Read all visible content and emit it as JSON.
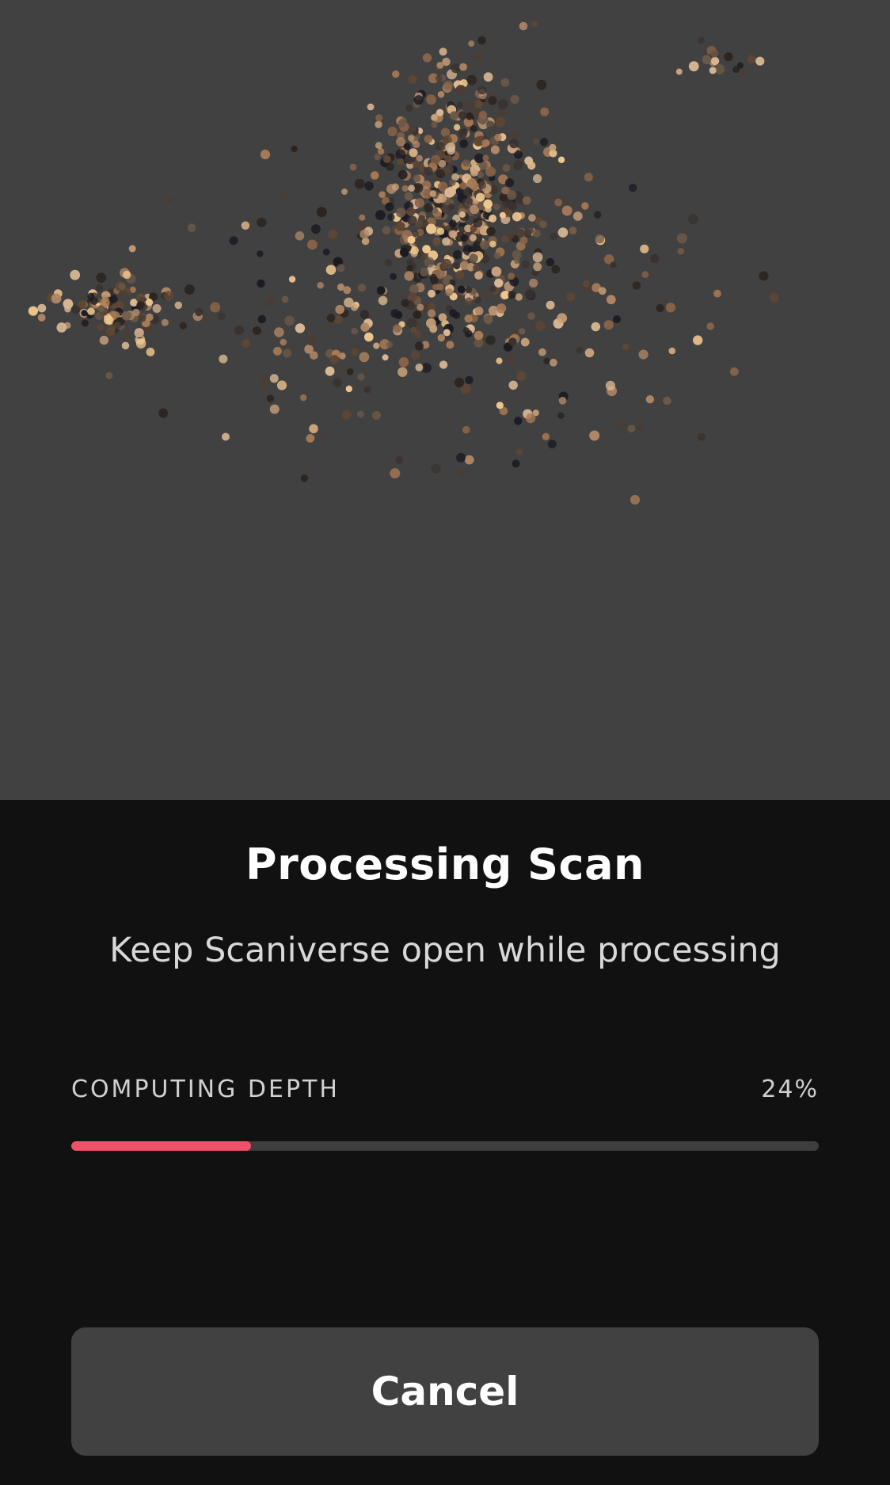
{
  "screen": {
    "title": "Processing Scan",
    "subtitle": "Keep Scaniverse open while processing"
  },
  "progress": {
    "label": "COMPUTING DEPTH",
    "percent_text": "24%",
    "value": 0.24
  },
  "actions": {
    "cancel_label": "Cancel"
  },
  "colors": {
    "viewport_bg": "#414141",
    "panel_bg": "#111111",
    "progress_fill": "#f0506a",
    "progress_track": "#3e3e3e",
    "button_bg": "#414141"
  }
}
